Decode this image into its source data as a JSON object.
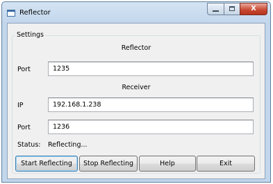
{
  "window": {
    "title": "Reflector",
    "close_glyph": "X"
  },
  "settings": {
    "group_label": "Settings",
    "reflector_section": "Reflector",
    "receiver_section": "Receiver",
    "reflector_port": {
      "label": "Port",
      "value": "1235"
    },
    "receiver_ip": {
      "label": "IP",
      "value": "192.168.1.238"
    },
    "receiver_port": {
      "label": "Port",
      "value": "1236"
    },
    "status": {
      "label": "Status:",
      "value": "Reflecting..."
    }
  },
  "buttons": {
    "start": "Start Reflecting",
    "stop": "Stop Reflecting",
    "help": "Help",
    "exit": "Exit"
  },
  "colors": {
    "frame": "#c2d6ec",
    "client": "#f0f0f0",
    "close_button": "#c7462e"
  }
}
